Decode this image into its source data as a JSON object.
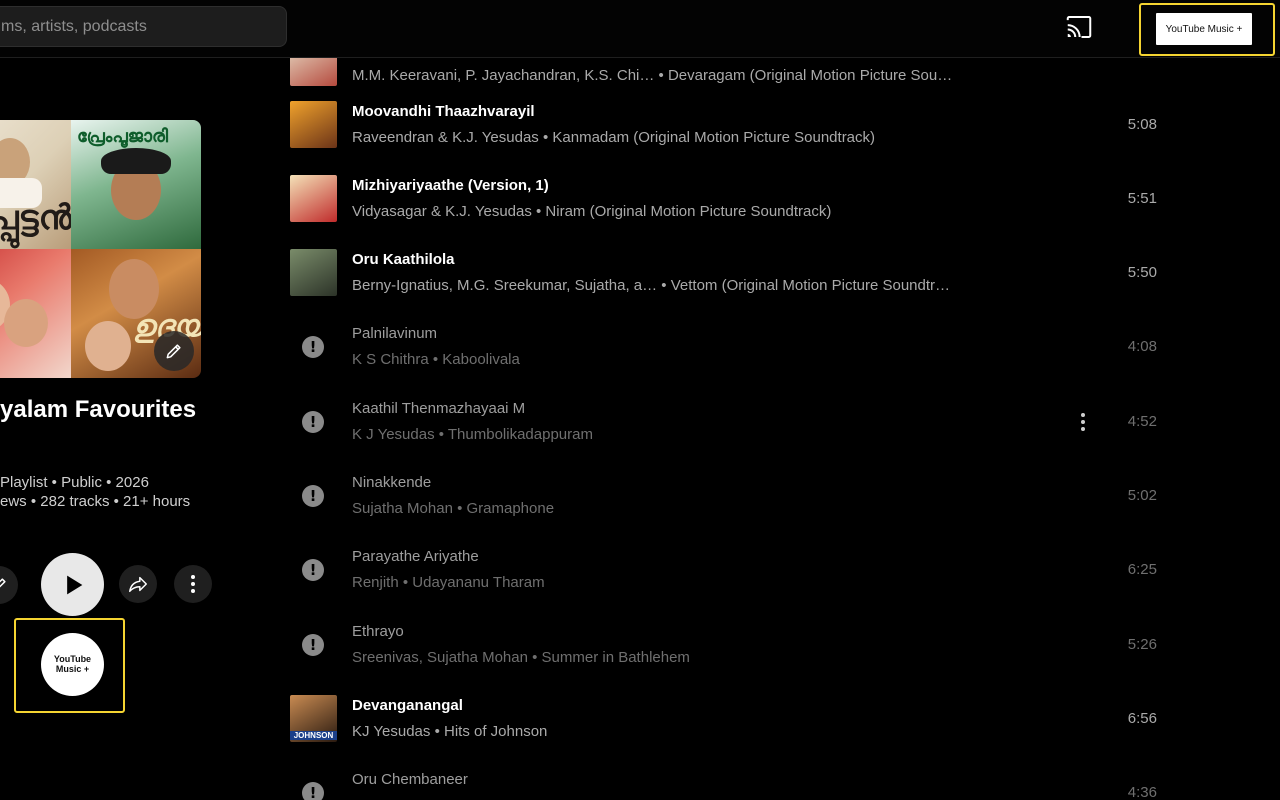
{
  "search": {
    "placeholder": "ms, artists, podcasts"
  },
  "header": {
    "ytm_plus_label": "YouTube Music +"
  },
  "playlist": {
    "title": "yalam Favourites",
    "meta_line1": "Playlist • Public • 2026",
    "meta_line2": "ews • 282 tracks • 21+ hours",
    "ytm_plus_label": "YouTube Music +",
    "cover_text": [
      "ംപ്പുട്ടൻ",
      "പ്രേംപൂജാരി",
      "",
      "ഉദയം"
    ]
  },
  "tracks": [
    {
      "title": "",
      "subtitle": "M.M. Keeravani, P. Jayachandran, K.S. Chi…  • Devaragam (Original Motion Picture Sou…",
      "duration": "",
      "available": true,
      "thumb_colors": [
        "#e9e0c9",
        "#b54a3e"
      ]
    },
    {
      "title": "Moovandhi Thaazhvarayil",
      "subtitle": "Raveendran & K.J. Yesudas • Kanmadam (Original Motion Picture Soundtrack)",
      "duration": "5:08",
      "available": true,
      "thumb_colors": [
        "#f0a22c",
        "#6b3318"
      ]
    },
    {
      "title": "Mizhiyariyaathe (Version, 1)",
      "subtitle": "Vidyasagar & K.J. Yesudas • Niram (Original Motion Picture Soundtrack)",
      "duration": "5:51",
      "available": true,
      "thumb_colors": [
        "#f4e2b8",
        "#c02b2b"
      ]
    },
    {
      "title": "Oru Kaathilola",
      "subtitle": "Berny-Ignatius, M.G. Sreekumar, Sujatha, a… • Vettom (Original Motion Picture Soundtr…",
      "duration": "5:50",
      "available": true,
      "thumb_colors": [
        "#7a8c6a",
        "#2c3328"
      ]
    },
    {
      "title": "Palnilavinum",
      "subtitle": "K S Chithra • Kaboolivala",
      "duration": "4:08",
      "available": false
    },
    {
      "title": "Kaathil Thenmazhayaai M",
      "subtitle": "K J Yesudas • Thumbolikadappuram",
      "duration": "4:52",
      "available": false,
      "menu": true
    },
    {
      "title": "Ninakkende",
      "subtitle": "Sujatha Mohan • Gramaphone",
      "duration": "5:02",
      "available": false
    },
    {
      "title": "Parayathe Ariyathe",
      "subtitle": "Renjith • Udayananu Tharam",
      "duration": "6:25",
      "available": false
    },
    {
      "title": "Ethrayo",
      "subtitle": "Sreenivas, Sujatha Mohan • Summer in Bathlehem",
      "duration": "5:26",
      "available": false
    },
    {
      "title": "Devanganangal",
      "subtitle": "KJ Yesudas • Hits of Johnson",
      "duration": "6:56",
      "available": true,
      "thumb_colors": [
        "#c98b52",
        "#2a1a10"
      ],
      "thumb_label": "JOHNSON"
    },
    {
      "title": "Oru Chembaneer",
      "subtitle": "",
      "duration": "4:36",
      "available": false
    }
  ]
}
